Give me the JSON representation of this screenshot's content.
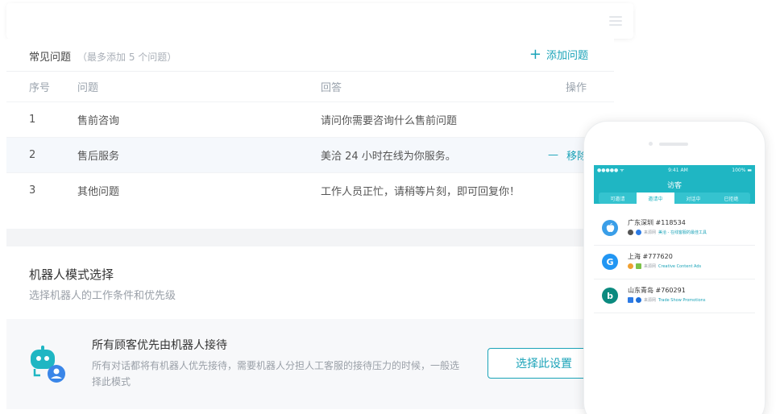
{
  "faq": {
    "title": "常见问题",
    "note": "（最多添加 5 个问题）",
    "add_label": "添加问题",
    "columns": {
      "no": "序号",
      "question": "问题",
      "answer": "回答",
      "action": "操作"
    },
    "rows": [
      {
        "no": "1",
        "question": "售前咨询",
        "answer": "请问你需要咨询什么售前问题"
      },
      {
        "no": "2",
        "question": "售后服务",
        "answer": "美洽 24 小时在线为你服务。",
        "action": "移除"
      },
      {
        "no": "3",
        "question": "其他问题",
        "answer": "工作人员正忙，请稍等片刻，即可回复你！"
      }
    ]
  },
  "robot": {
    "title": "机器人模式选择",
    "subtitle": "选择机器人的工作条件和优先级",
    "option_title": "所有顾客优先由机器人接待",
    "option_desc": "所有对话都将有机器人优先接待，需要机器人分担人工客服的接待压力的时候，一般选择此模式",
    "select_label": "选择此设置"
  },
  "phone": {
    "status_left": "●●●●● ᯤ",
    "status_time": "9:41 AM",
    "status_right": "100% ▬",
    "app_title": "访客",
    "tabs": [
      "可邀请",
      "邀请中",
      "对话中",
      "已拒绝"
    ],
    "active_tab": 1,
    "visitors": [
      {
        "name": "广东深圳 #118534",
        "avatar_letter": "",
        "avatar_color": "#3a9ee8",
        "meta_prefix": "来源网",
        "meta_link": "美洽 - 在线客服的最佳工具"
      },
      {
        "name": "上海 #777620",
        "avatar_letter": "G",
        "avatar_color": "#2196f3",
        "meta_prefix": "来源网",
        "meta_link": "Creative Content Ads"
      },
      {
        "name": "山东青岛 #760291",
        "avatar_letter": "b",
        "avatar_color": "#0b8a7f",
        "meta_prefix": "来源网",
        "meta_link": "Trade Show Promotions"
      }
    ]
  },
  "colors": {
    "accent": "#1aa3b8",
    "teal": "#1fb6c3"
  }
}
